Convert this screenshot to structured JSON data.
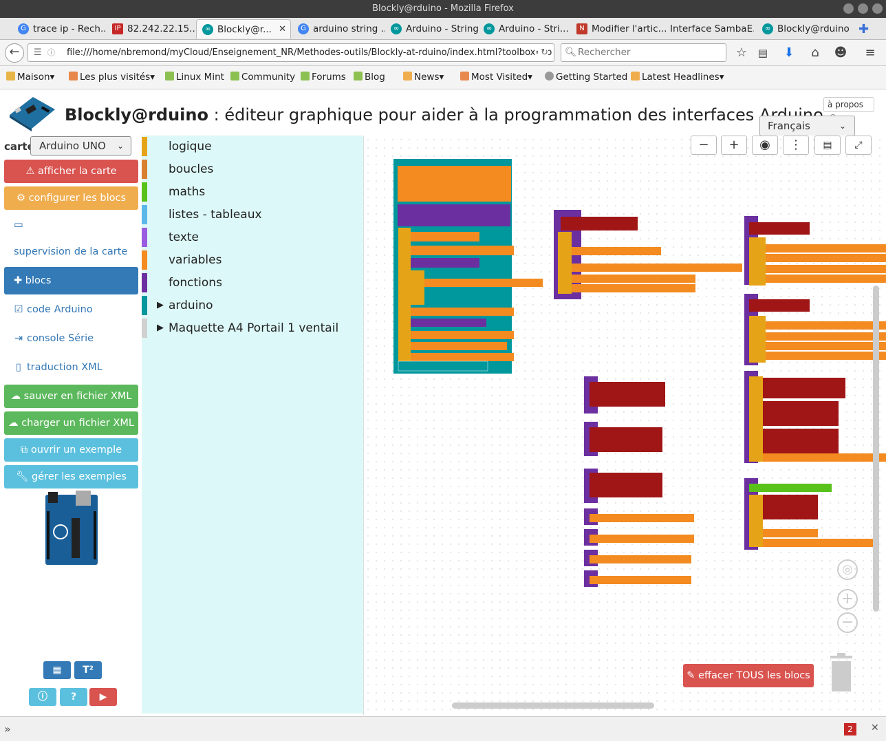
{
  "browser": {
    "window_title": "Blockly@rduino - Mozilla Firefox",
    "tabs": [
      {
        "label": "trace ip - Rech...",
        "icon": "google-icon",
        "color": "#4285f4"
      },
      {
        "label": "82.242.22.15...",
        "icon": "ip-icon",
        "color": "#c62828"
      },
      {
        "label": "Blockly@r...",
        "icon": "arduino-icon",
        "color": "#00979d",
        "active": true
      },
      {
        "label": "arduino string ...",
        "icon": "google-icon",
        "color": "#4285f4"
      },
      {
        "label": "Arduino - String",
        "icon": "arduino-icon",
        "color": "#00979d"
      },
      {
        "label": "Arduino - Stri...",
        "icon": "arduino-icon",
        "color": "#00979d"
      },
      {
        "label": "Modifier l'artic...",
        "icon": "spip-icon",
        "color": "#c0392b"
      },
      {
        "label": "Interface SambaE...",
        "icon": "",
        "color": "#888"
      },
      {
        "label": "Blockly@rduino",
        "icon": "arduino-icon",
        "color": "#00979d"
      }
    ],
    "url": "file:///home/nbremond/myCloud/Enseignement_NR/Methodes-outils/Blockly-at-rduino/index.html?toolbox=to",
    "search_placeholder": "Rechercher",
    "bookmarks": [
      {
        "label": "Maison",
        "dropdown": true
      },
      {
        "label": "Les plus visités",
        "dropdown": true
      },
      {
        "label": "Linux Mint",
        "dropdown": false
      },
      {
        "label": "Community",
        "dropdown": false
      },
      {
        "label": "Forums",
        "dropdown": false
      },
      {
        "label": "Blog",
        "dropdown": false
      },
      {
        "label": "News",
        "dropdown": true
      },
      {
        "label": "Most Visited",
        "dropdown": true
      },
      {
        "label": "Getting Started",
        "dropdown": false
      },
      {
        "label": "Latest Headlines",
        "dropdown": true
      }
    ],
    "status_badge": "2"
  },
  "app": {
    "title_bold": "Blockly@rduino",
    "title_rest": " : éditeur graphique pour aider à la programmation des interfaces Arduino",
    "apropos": "à propos",
    "language": "Français",
    "carte_label": "carte",
    "carte_value": "Arduino UNO"
  },
  "sidebar": {
    "afficher": "afficher la carte",
    "configurer": "configurer les blocs",
    "supervision": "supervision de la carte",
    "blocs": "blocs",
    "code": "code Arduino",
    "console": "console Série",
    "traduction": "traduction XML",
    "sauver": "sauver en fichier XML",
    "charger": "charger un fichier XML",
    "ouvrir": "ouvrir un exemple",
    "gerer": "gérer les exemples"
  },
  "toolbox": {
    "categories": [
      {
        "label": "logique",
        "color": "#e5a417"
      },
      {
        "label": "boucles",
        "color": "#d98030"
      },
      {
        "label": "maths",
        "color": "#59c21a"
      },
      {
        "label": "listes - tableaux",
        "color": "#5bb8e8"
      },
      {
        "label": "texte",
        "color": "#9a5be0"
      },
      {
        "label": "variables",
        "color": "#f38b20"
      },
      {
        "label": "fonctions",
        "color": "#6b2fa0"
      },
      {
        "label": "arduino",
        "color": "#00979d",
        "expandable": true
      },
      {
        "label": "Maquette A4 Portail 1 ventail",
        "color": "#d0d0d0",
        "expandable": true
      }
    ]
  },
  "workspace": {
    "effacer": "effacer TOUS les blocs"
  },
  "colors": {
    "danger": "#d9534f",
    "warning": "#f0ad4e",
    "primary": "#337ab7",
    "success": "#5cb85c",
    "info": "#5bc0de"
  }
}
